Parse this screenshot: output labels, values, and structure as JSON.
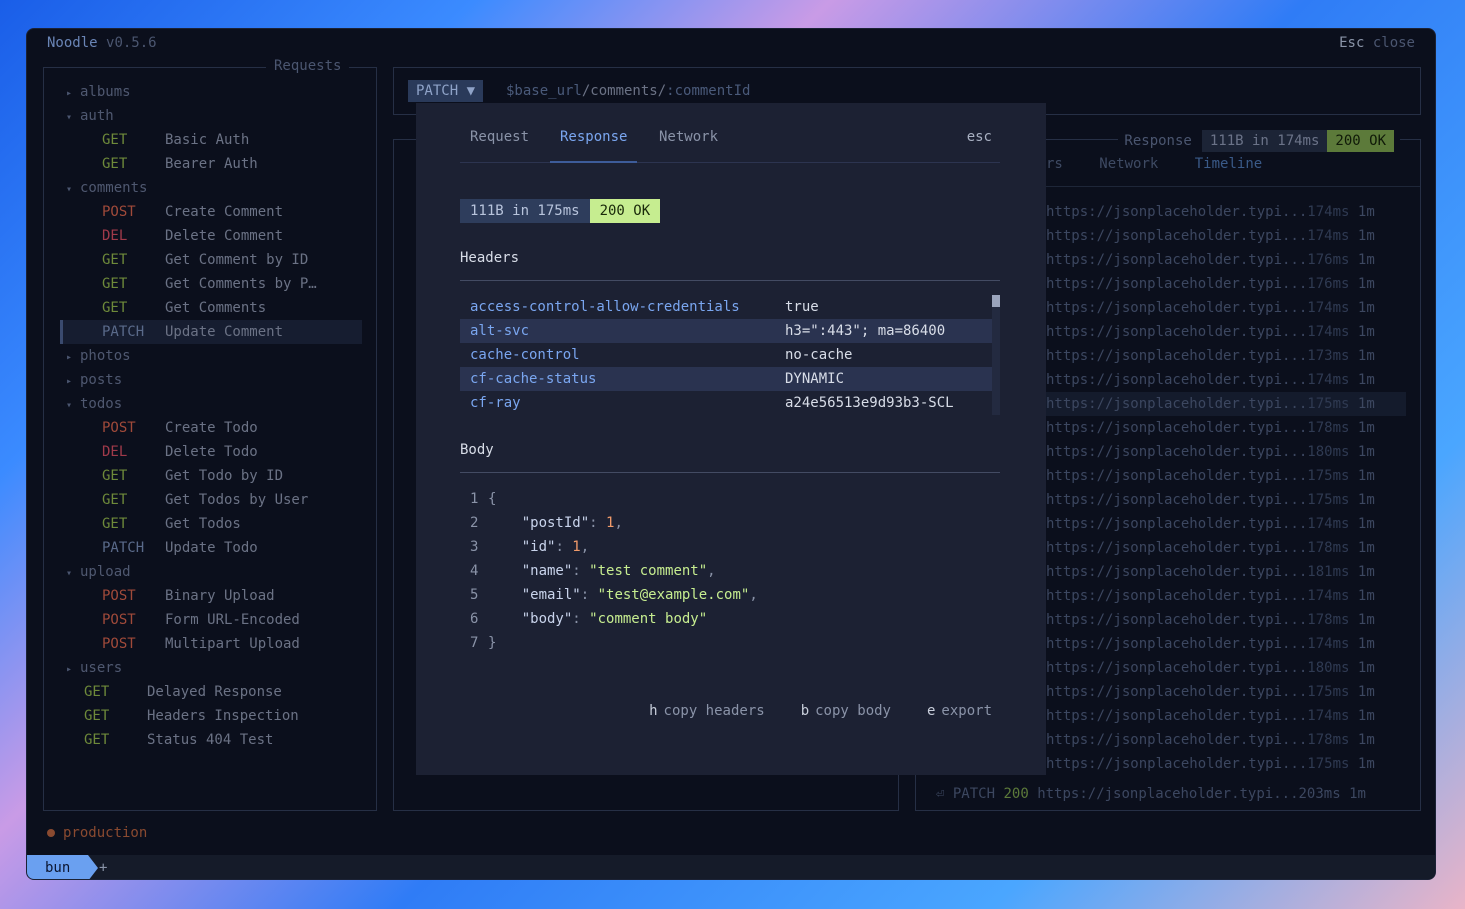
{
  "app": {
    "name": "Noodle",
    "version": "v0.5.6",
    "close_key": "Esc",
    "close_label": "close"
  },
  "requests_panel": {
    "title": "Requests",
    "items": [
      {
        "type": "folder",
        "name": "albums",
        "open": false
      },
      {
        "type": "folder",
        "name": "auth",
        "open": true
      },
      {
        "type": "req",
        "method": "GET",
        "name": "Basic Auth"
      },
      {
        "type": "req",
        "method": "GET",
        "name": "Bearer Auth"
      },
      {
        "type": "folder",
        "name": "comments",
        "open": true
      },
      {
        "type": "req",
        "method": "POST",
        "name": "Create Comment"
      },
      {
        "type": "req",
        "method": "DEL",
        "name": "Delete Comment"
      },
      {
        "type": "req",
        "method": "GET",
        "name": "Get Comment by ID"
      },
      {
        "type": "req",
        "method": "GET",
        "name": "Get Comments by P…"
      },
      {
        "type": "req",
        "method": "GET",
        "name": "Get Comments"
      },
      {
        "type": "req",
        "method": "PATCH",
        "name": "Update Comment",
        "selected": true
      },
      {
        "type": "folder",
        "name": "photos",
        "open": false
      },
      {
        "type": "folder",
        "name": "posts",
        "open": false
      },
      {
        "type": "folder",
        "name": "todos",
        "open": true
      },
      {
        "type": "req",
        "method": "POST",
        "name": "Create Todo"
      },
      {
        "type": "req",
        "method": "DEL",
        "name": "Delete Todo"
      },
      {
        "type": "req",
        "method": "GET",
        "name": "Get Todo by ID"
      },
      {
        "type": "req",
        "method": "GET",
        "name": "Get Todos by User"
      },
      {
        "type": "req",
        "method": "GET",
        "name": "Get Todos"
      },
      {
        "type": "req",
        "method": "PATCH",
        "name": "Update Todo"
      },
      {
        "type": "folder",
        "name": "upload",
        "open": true
      },
      {
        "type": "req",
        "method": "POST",
        "name": "Binary Upload"
      },
      {
        "type": "req",
        "method": "POST",
        "name": "Form URL-Encoded"
      },
      {
        "type": "req",
        "method": "POST",
        "name": "Multipart Upload"
      },
      {
        "type": "folder",
        "name": "users",
        "open": false
      },
      {
        "type": "req-top",
        "method": "GET",
        "name": "Delayed Response"
      },
      {
        "type": "req-top",
        "method": "GET",
        "name": "Headers Inspection"
      },
      {
        "type": "req-top",
        "method": "GET",
        "name": "Status 404 Test"
      }
    ]
  },
  "url_bar": {
    "method": "PATCH",
    "method_caret": "▼",
    "url_var": "$base_url",
    "url_path": "/comments/",
    "url_param": ":commentId"
  },
  "response_panel": {
    "title": "Response",
    "size_time": "111B in 174ms",
    "status": "200 OK",
    "tabs": [
      "rs",
      "Network",
      "Timeline"
    ],
    "active_tab": "Timeline",
    "history": [
      {
        "url": "https://jsonplaceholder.typi...",
        "time": "174ms",
        "age": "1m"
      },
      {
        "url": "https://jsonplaceholder.typi...",
        "time": "174ms",
        "age": "1m"
      },
      {
        "url": "https://jsonplaceholder.typi...",
        "time": "176ms",
        "age": "1m"
      },
      {
        "url": "https://jsonplaceholder.typi...",
        "time": "176ms",
        "age": "1m"
      },
      {
        "url": "https://jsonplaceholder.typi...",
        "time": "174ms",
        "age": "1m"
      },
      {
        "url": "https://jsonplaceholder.typi...",
        "time": "174ms",
        "age": "1m"
      },
      {
        "url": "https://jsonplaceholder.typi...",
        "time": "173ms",
        "age": "1m"
      },
      {
        "url": "https://jsonplaceholder.typi...",
        "time": "174ms",
        "age": "1m"
      },
      {
        "url": "https://jsonplaceholder.typi...",
        "time": "175ms",
        "age": "1m",
        "highlight": true
      },
      {
        "url": "https://jsonplaceholder.typi...",
        "time": "178ms",
        "age": "1m"
      },
      {
        "url": "https://jsonplaceholder.typi...",
        "time": "180ms",
        "age": "1m"
      },
      {
        "url": "https://jsonplaceholder.typi...",
        "time": "175ms",
        "age": "1m"
      },
      {
        "url": "https://jsonplaceholder.typi...",
        "time": "175ms",
        "age": "1m"
      },
      {
        "url": "https://jsonplaceholder.typi...",
        "time": "174ms",
        "age": "1m"
      },
      {
        "url": "https://jsonplaceholder.typi...",
        "time": "178ms",
        "age": "1m"
      },
      {
        "url": "https://jsonplaceholder.typi...",
        "time": "181ms",
        "age": "1m"
      },
      {
        "url": "https://jsonplaceholder.typi...",
        "time": "174ms",
        "age": "1m"
      },
      {
        "url": "https://jsonplaceholder.typi...",
        "time": "178ms",
        "age": "1m"
      },
      {
        "url": "https://jsonplaceholder.typi...",
        "time": "174ms",
        "age": "1m"
      },
      {
        "url": "https://jsonplaceholder.typi...",
        "time": "180ms",
        "age": "1m"
      },
      {
        "url": "https://jsonplaceholder.typi...",
        "time": "175ms",
        "age": "1m"
      },
      {
        "url": "https://jsonplaceholder.typi...",
        "time": "174ms",
        "age": "1m"
      },
      {
        "url": "https://jsonplaceholder.typi...",
        "time": "178ms",
        "age": "1m"
      },
      {
        "url": "https://jsonplaceholder.typi...",
        "time": "175ms",
        "age": "1m"
      }
    ],
    "last": {
      "icon": "⏎",
      "method": "PATCH",
      "status": "200",
      "url": "https://jsonplaceholder.typi...",
      "time": "203ms",
      "age": "1m"
    }
  },
  "environment": {
    "name": "production",
    "color": "#8a4a30"
  },
  "terminal": {
    "tab": "bun",
    "new_tab": "+"
  },
  "modal": {
    "tabs": [
      "Request",
      "Response",
      "Network"
    ],
    "active_tab": "Response",
    "close": "esc",
    "size_time": "111B in 175ms",
    "status": "200 OK",
    "headers_title": "Headers",
    "headers": [
      {
        "k": "access-control-allow-credentials",
        "v": "true"
      },
      {
        "k": "alt-svc",
        "v": "h3=\":443\"; ma=86400"
      },
      {
        "k": "cache-control",
        "v": "no-cache"
      },
      {
        "k": "cf-cache-status",
        "v": "DYNAMIC"
      },
      {
        "k": "cf-ray",
        "v": "a24e56513e9d93b3-SCL"
      }
    ],
    "body_title": "Body",
    "body_lines": [
      "1",
      "2",
      "3",
      "4",
      "5",
      "6",
      "7"
    ],
    "body": {
      "open": "{",
      "close": "}",
      "fields": [
        {
          "key": "\"postId\"",
          "val": "1",
          "kind": "num",
          "comma": ","
        },
        {
          "key": "\"id\"",
          "val": "1",
          "kind": "num",
          "comma": ","
        },
        {
          "key": "\"name\"",
          "val": "\"test comment\"",
          "kind": "str",
          "comma": ","
        },
        {
          "key": "\"email\"",
          "val": "\"test@example.com\"",
          "kind": "str",
          "comma": ","
        },
        {
          "key": "\"body\"",
          "val": "\"comment body\"",
          "kind": "str",
          "comma": ""
        }
      ]
    },
    "footer": [
      {
        "key": "h",
        "label": "copy headers"
      },
      {
        "key": "b",
        "label": "copy body"
      },
      {
        "key": "e",
        "label": "export"
      }
    ]
  }
}
